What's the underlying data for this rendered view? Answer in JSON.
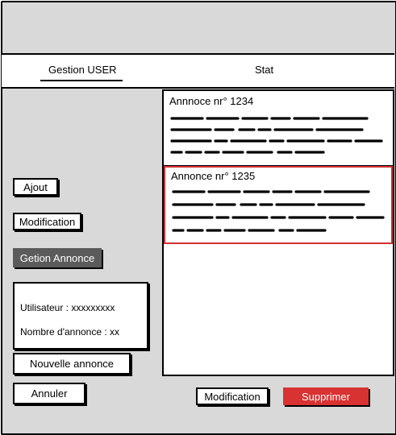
{
  "nav": {
    "tab_user": "Gestion USER",
    "tab_stat": "Stat"
  },
  "sidebar": {
    "ajout": "Ajout",
    "modification": "Modification",
    "gestion_annonce": "Getion Annonce"
  },
  "info": {
    "utilisateur": "Utilisateur : xxxxxxxxx",
    "nombre_annonce": "Nombre d'annonce : xx"
  },
  "actions": {
    "nouvelle_annonce": "Nouvelle annonce",
    "annuler": "Annuler",
    "modification": "Modification",
    "supprimer": "Supprimer"
  },
  "annonces": [
    {
      "title": "Annnoce nr° 1234"
    },
    {
      "title": "Annonce nr° 1235"
    }
  ],
  "colors": {
    "selected_border": "#d03030",
    "delete_button": "#d93232",
    "active_sidebar": "#5b5b5b"
  }
}
